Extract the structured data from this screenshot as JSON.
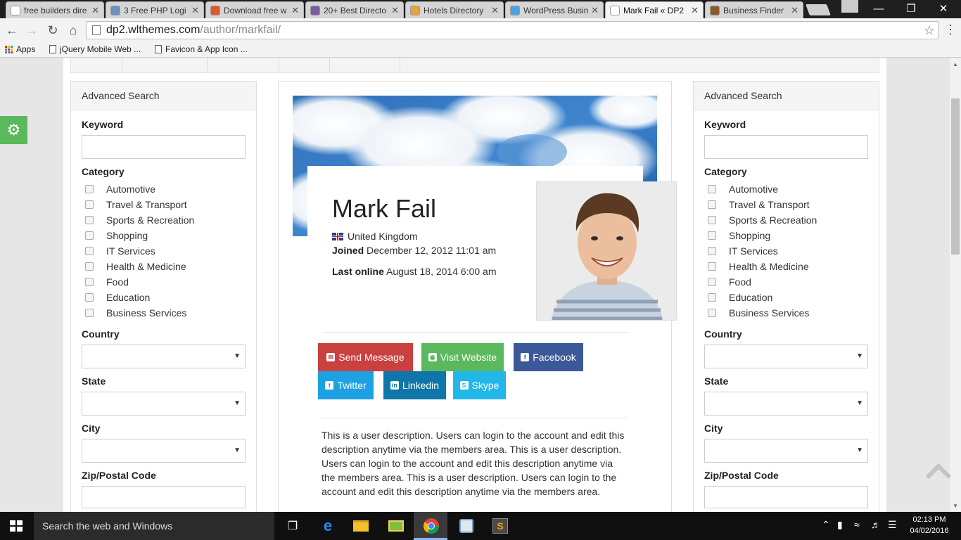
{
  "browser": {
    "tabs": [
      {
        "title": "free builders dire",
        "favicon": "google-icon",
        "color": "#ffffff"
      },
      {
        "title": "3 Free PHP Logi",
        "favicon": "t-icon",
        "color": "#6d8fc4"
      },
      {
        "title": "Download free w",
        "favicon": "hexagon-icon",
        "color": "#e0572f"
      },
      {
        "title": "20+ Best Directo",
        "favicon": "colorlib-icon",
        "color": "#7b5aa6"
      },
      {
        "title": "Hotels Directory",
        "favicon": "star-icon",
        "color": "#e8a23c"
      },
      {
        "title": "WordPress Busin",
        "favicon": "globe-icon",
        "color": "#4aa3df"
      },
      {
        "title": "Mark Fail « DP2",
        "favicon": "page-icon",
        "color": "#ffffff",
        "active": true
      },
      {
        "title": "Business Finder",
        "favicon": "image-icon",
        "color": "#8a5a2b"
      }
    ],
    "url_host": "dp2.wlthemes.com",
    "url_path": "/author/markfail/",
    "bookmarks": [
      {
        "label": "Apps",
        "icon": "apps-grid-icon"
      },
      {
        "label": "jQuery Mobile Web ...",
        "icon": "page-icon"
      },
      {
        "label": "Favicon & App Icon ...",
        "icon": "page-icon"
      }
    ]
  },
  "sidebar": {
    "title": "Advanced Search",
    "keyword_label": "Keyword",
    "category_label": "Category",
    "categories": [
      "Automotive",
      "Travel & Transport",
      "Sports & Recreation",
      "Shopping",
      "IT Services",
      "Health & Medicine",
      "Food",
      "Education",
      "Business Services"
    ],
    "country_label": "Country",
    "state_label": "State",
    "city_label": "City",
    "zip_label": "Zip/Postal Code"
  },
  "profile": {
    "name": "Mark Fail",
    "country": "United Kingdom",
    "joined_label": "Joined",
    "joined_value": "December 12, 2012 11:01 am",
    "last_online_label": "Last online",
    "last_online_value": "August 18, 2014 6:00 am",
    "buttons": [
      {
        "label": "Send Message",
        "icon": "envelope-icon",
        "color": "#c9403f"
      },
      {
        "label": "Visit Website",
        "icon": "globe-icon",
        "color": "#5cb85c"
      },
      {
        "label": "Facebook",
        "icon": "facebook-icon",
        "color": "#3b5998"
      },
      {
        "label": "Twitter",
        "icon": "twitter-icon",
        "color": "#1da1e2"
      },
      {
        "label": "Linkedin",
        "icon": "linkedin-icon",
        "color": "#0e76a8"
      },
      {
        "label": "Skype",
        "icon": "skype-icon",
        "color": "#21b8e9"
      }
    ],
    "description": "This is a user description. Users can login to the account and edit this description anytime via the members area. This is a user description. Users can login to the account and edit this description anytime via the members area. This is a user description. Users can login to the account and edit this description anytime via the members area."
  },
  "taskbar": {
    "search_placeholder": "Search the web and Windows",
    "time": "02:13 PM",
    "date": "04/02/2016"
  }
}
